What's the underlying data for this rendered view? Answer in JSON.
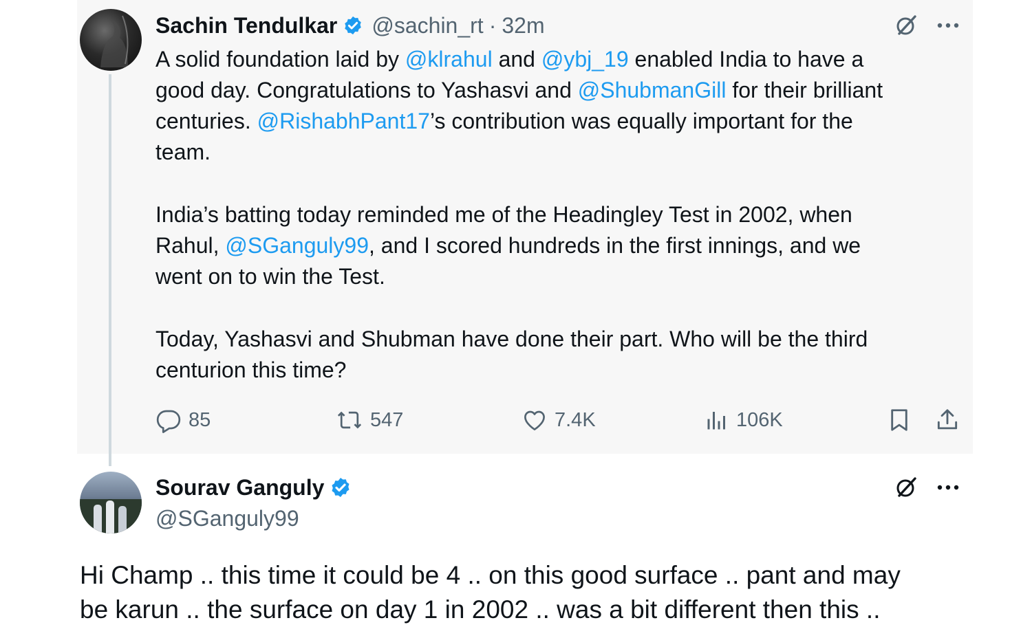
{
  "tweet1": {
    "author_name": "Sachin Tendulkar",
    "handle": "@sachin_rt",
    "separator": "·",
    "time": "32m",
    "line1": {
      "a": "A solid foundation laid by ",
      "m1": "@klrahul",
      "b": " and ",
      "m2": "@ybj_19",
      "c": " enabled India to have a"
    },
    "line2": {
      "a": "good day. Congratulations to Yashasvi and ",
      "m1": "@ShubmanGill",
      "b": " for their brilliant"
    },
    "line3": {
      "a": "centuries. ",
      "m1": "@RishabhPant17",
      "b": "’s contribution was equally important for the"
    },
    "line4": "team.",
    "line5": "India’s batting today reminded me of the Headingley Test in 2002, when",
    "line6": {
      "a": "Rahul, ",
      "m1": "@SGanguly99",
      "b": ", and I scored hundreds in the first innings, and we"
    },
    "line7": "went on to win the Test.",
    "line8": "Today, Yashasvi and Shubman have done their part. Who will be the third",
    "line9": "centurion this time?",
    "stats": {
      "replies": "85",
      "reposts": "547",
      "likes": "7.4K",
      "views": "106K"
    }
  },
  "tweet2": {
    "author_name": "Sourav Ganguly",
    "handle": "@SGanguly99",
    "line1": "Hi Champ .. this time it could be 4 .. on this good surface .. pant  and may",
    "line2": "be karun .. the surface on day 1 in 2002 .. was a bit different then this .."
  },
  "icons": {
    "verified": "verified-badge-icon",
    "grok": "grok-icon",
    "more": "more-icon",
    "reply": "reply-icon",
    "repost": "repost-icon",
    "like": "like-icon",
    "views": "views-icon",
    "bookmark": "bookmark-icon",
    "share": "share-icon"
  },
  "colors": {
    "mention": "#1d9bf0",
    "verified": "#1d9bf0",
    "muted": "#536471",
    "text": "#0f1419",
    "tweet_bg": "#f7f7f7"
  }
}
